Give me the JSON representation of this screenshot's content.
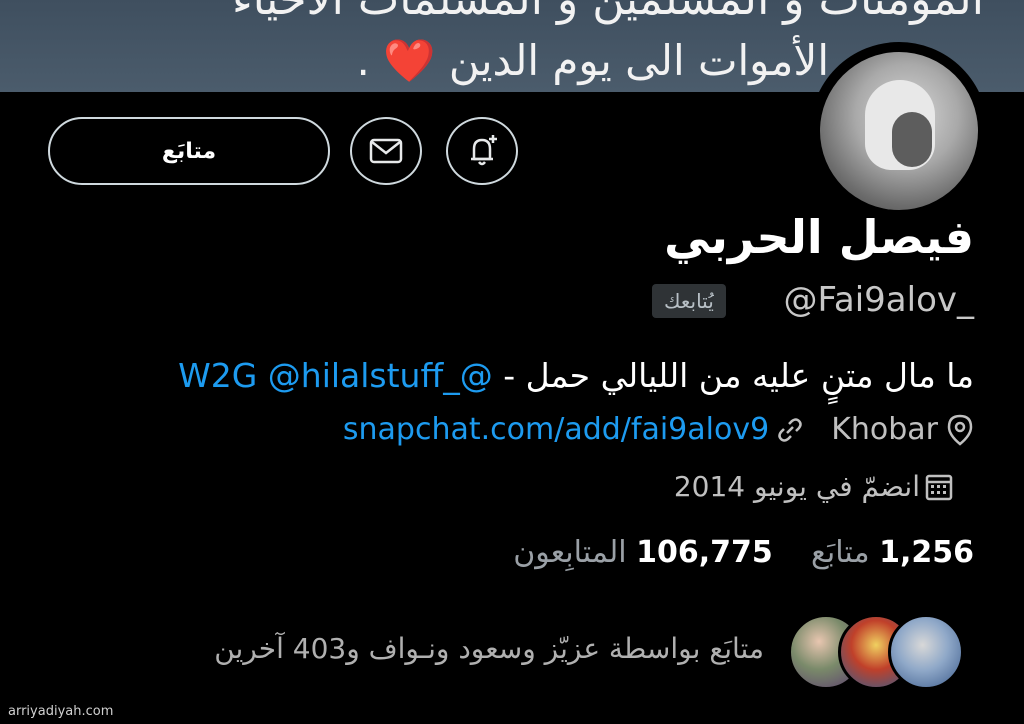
{
  "banner": {
    "line1": "المؤمنات و المسلمين و المسلمات الأحياء",
    "line2": "الأموات الى يوم الدين",
    "heart": "❤️"
  },
  "actions": {
    "follow_label": "متابَع"
  },
  "profile": {
    "name": "فيصل الحربي",
    "handle": "@Fai9alov_",
    "follows_you": "يُتابعك",
    "bio_text": "ما مال متنٍ عليه من الليالي حمل - ",
    "bio_mention1": "@_W2G",
    "bio_mention2": "@hilalstuff",
    "location": "Khobar",
    "website": "snapchat.com/add/fai9alov9",
    "joined": "انضمّ في يونيو 2014"
  },
  "stats": {
    "following_count": "1,256",
    "following_label": "متابَع",
    "followers_count": "106,775",
    "followers_label": "المتابِعون"
  },
  "followed_by": "متابَع بواسطة عزيّز وسعود ونـواف و403 آخرين",
  "watermark": "arriyadiyah.com",
  "colors": {
    "link": "#1d9bf0",
    "background": "#000000",
    "banner": "#4b5c6c"
  }
}
